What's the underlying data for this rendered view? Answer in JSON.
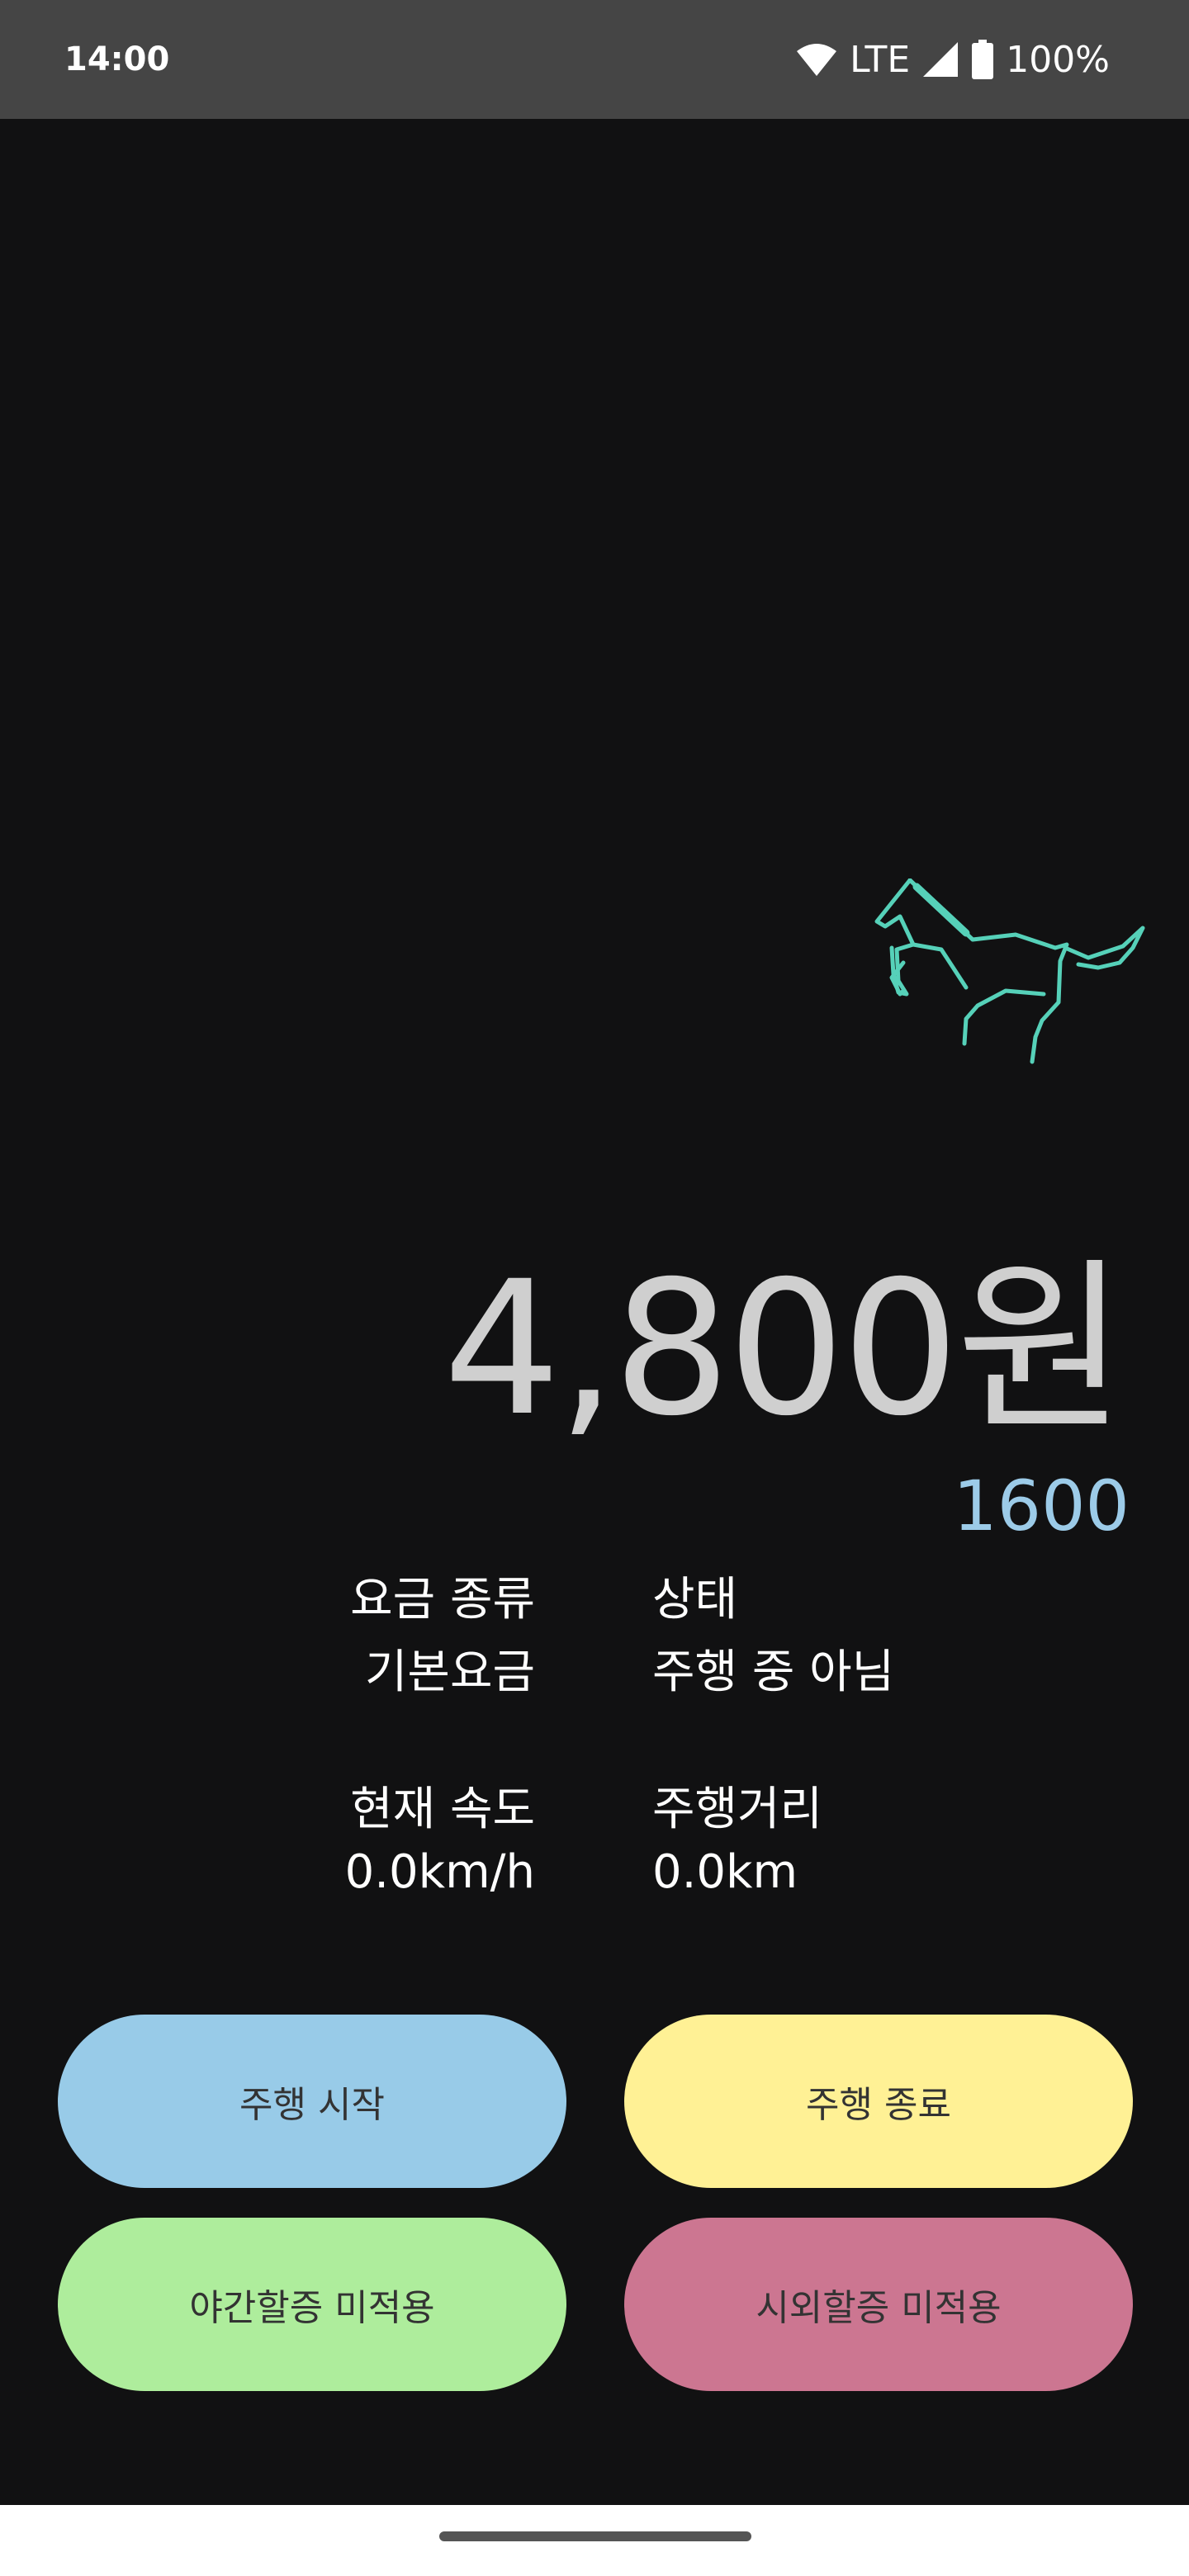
{
  "status_bar": {
    "time": "14:00",
    "network": "LTE",
    "battery": "100%",
    "icons": [
      "wifi-icon",
      "signal-icon",
      "battery-icon"
    ]
  },
  "meter": {
    "icon": "horse-icon",
    "fare": "4,800원",
    "sub_value": "1600"
  },
  "info": {
    "fare_type_label": "요금 종류",
    "fare_type_value": "기본요금",
    "status_label": "상태",
    "status_value": "주행 중 아님",
    "speed_label": "현재 속도",
    "speed_value": "0.0km/h",
    "distance_label": "주행거리",
    "distance_value": "0.0km"
  },
  "buttons": {
    "start": "주행 시작",
    "end": "주행 종료",
    "night": "야간할증 미적용",
    "outside": "시외할증 미적용"
  },
  "colors": {
    "start": "#98cbe8",
    "end": "#fff195",
    "night": "#aeed9c",
    "outside": "#cc7691",
    "accent_sub": "#9ccbe8",
    "horse": "#56d1b9"
  }
}
